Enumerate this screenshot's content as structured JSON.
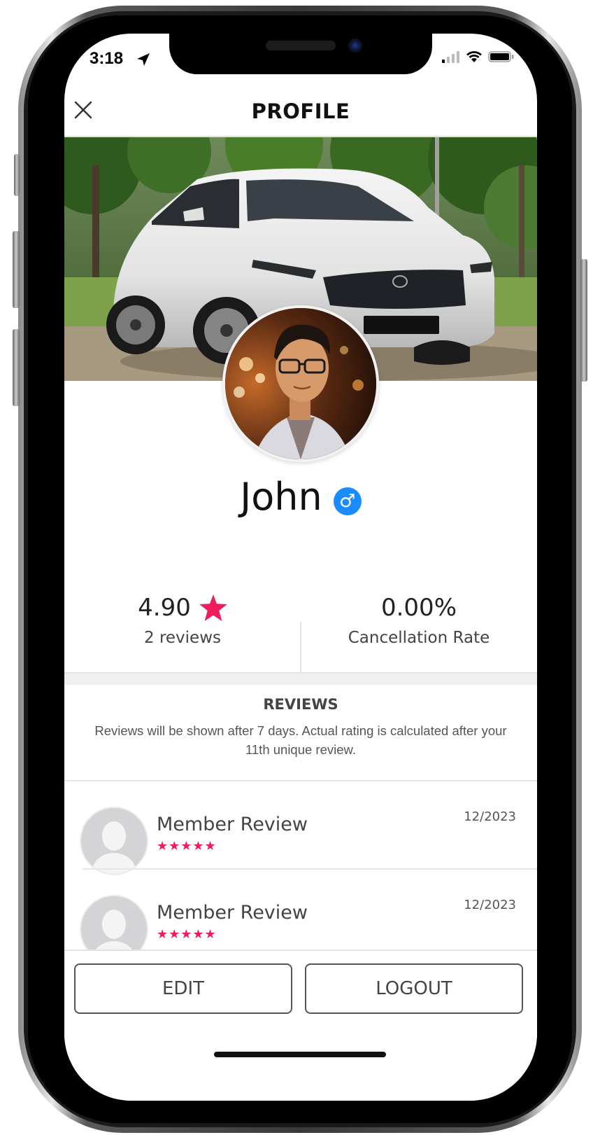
{
  "status_bar": {
    "time": "3:18",
    "icons": [
      "location-arrow-icon",
      "signal-icon",
      "wifi-icon",
      "battery-icon"
    ]
  },
  "header": {
    "title": "PROFILE",
    "close_icon": "close-icon"
  },
  "profile": {
    "name": "John",
    "gender_symbol": "♂",
    "cover_image": "white Mazda crossover parked in a park",
    "avatar_image": "portrait of man with glasses"
  },
  "stats": {
    "rating": "4.90",
    "rating_icon": "star-icon",
    "reviews_label": "2 reviews",
    "cancellation_value": "0.00%",
    "cancellation_label": "Cancellation Rate"
  },
  "reviews": {
    "title": "REVIEWS",
    "note": "Reviews will be shown after 7 days. Actual rating is calculated after your 11th unique review.",
    "items": [
      {
        "name": "Member Review",
        "stars": "★★★★★",
        "date": "12/2023"
      },
      {
        "name": "Member Review",
        "stars": "★★★★★",
        "date": "12/2023"
      }
    ]
  },
  "actions": {
    "edit_label": "EDIT",
    "logout_label": "LOGOUT"
  },
  "colors": {
    "accent_pink": "#f01c5c",
    "gender_blue": "#1a8cff"
  }
}
